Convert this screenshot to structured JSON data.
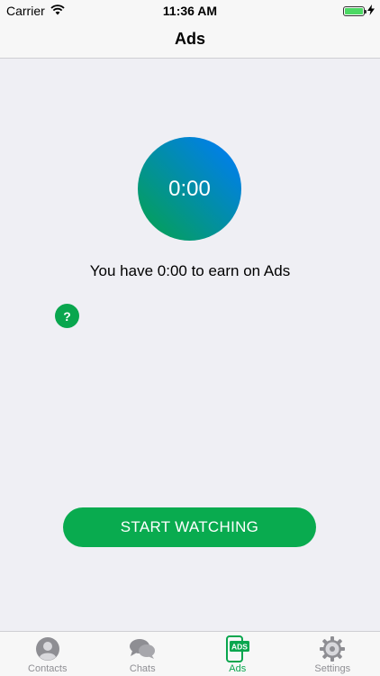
{
  "status_bar": {
    "carrier": "Carrier",
    "time": "11:36 AM",
    "icons": [
      "wifi-icon",
      "battery-icon",
      "charging-bolt-icon"
    ]
  },
  "nav": {
    "title": "Ads"
  },
  "timer": {
    "value": "0:00"
  },
  "earn_text": "You have 0:00 to earn on Ads",
  "help": {
    "label": "?"
  },
  "start_button": {
    "label": "START WATCHING"
  },
  "tabs": [
    {
      "label": "Contacts",
      "icon": "contacts-icon",
      "active": false
    },
    {
      "label": "Chats",
      "icon": "chats-icon",
      "active": false
    },
    {
      "label": "Ads",
      "icon": "ads-icon",
      "active": true,
      "icon_text": "ADS"
    },
    {
      "label": "Settings",
      "icon": "settings-icon",
      "active": false
    }
  ],
  "colors": {
    "accent_green": "#09a64e",
    "gradient_blue": "#007aff",
    "gradient_green": "#05a34a",
    "inactive_gray": "#8e8e93",
    "background": "#efeff4"
  }
}
